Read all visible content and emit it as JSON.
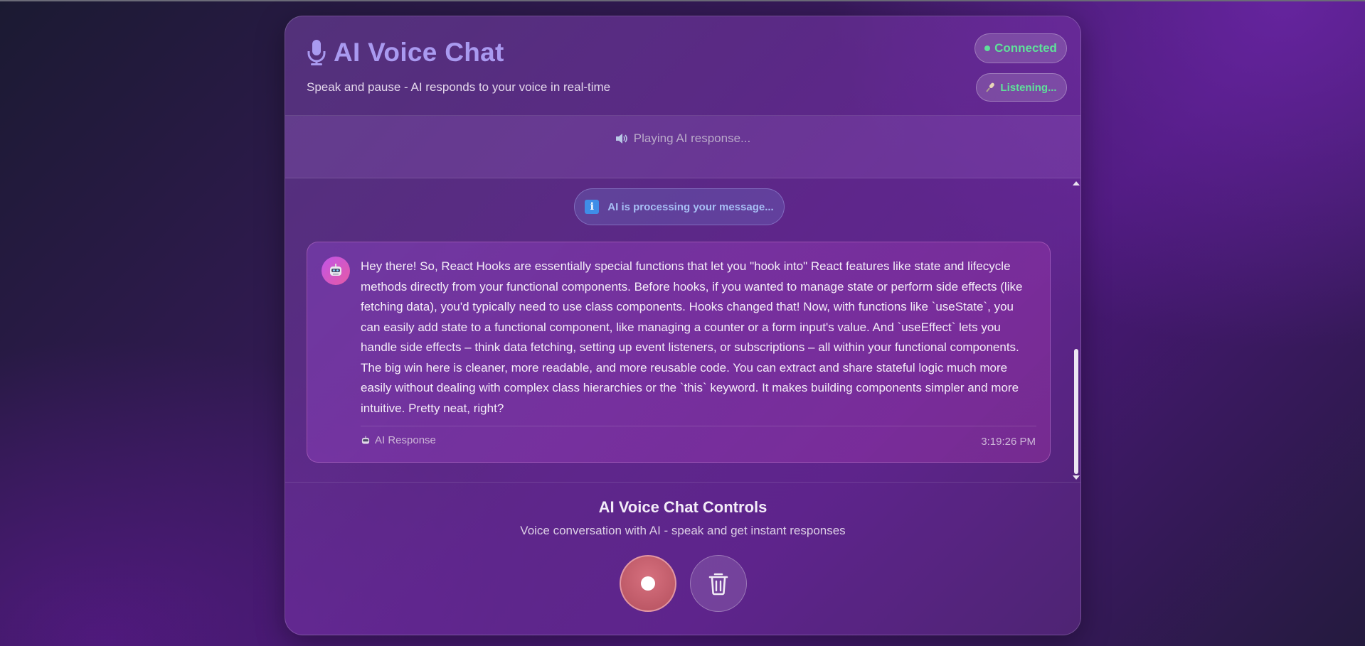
{
  "app": {
    "title": "AI Voice Chat",
    "subtitle": "Speak and pause - AI responds to your voice in real-time"
  },
  "status": {
    "connection": "Connected",
    "listening": "Listening..."
  },
  "playback": {
    "text": "Playing AI response..."
  },
  "processing": {
    "text": "AI is processing your message..."
  },
  "message": {
    "text": "Hey there! So, React Hooks are essentially special functions that let you \"hook into\" React features like state and lifecycle methods directly from your functional components. Before hooks, if you wanted to manage state or perform side effects (like fetching data), you'd typically need to use class components. Hooks changed that! Now, with functions like `useState`, you can easily add state to a functional component, like managing a counter or a form input's value. And `useEffect` lets you handle side effects – think data fetching, setting up event listeners, or subscriptions – all within your functional components. The big win here is cleaner, more readable, and more reusable code. You can extract and share stateful logic much more easily without dealing with complex class hierarchies or the `this` keyword. It makes building components simpler and more intuitive. Pretty neat, right?",
    "label": "AI Response",
    "time": "3:19:26 PM"
  },
  "controls": {
    "title": "AI Voice Chat Controls",
    "subtitle": "Voice conversation with AI - speak and get instant responses"
  },
  "icons": {
    "title": "microphone-icon",
    "listening": "microphone-icon",
    "playback": "speaker-icon",
    "processing": "info-icon",
    "avatar": "robot-icon",
    "record": "record-icon",
    "delete": "trash-icon"
  },
  "colors": {
    "accent": "#a99af0",
    "status_green": "#5fe09a",
    "record": "#c4606e",
    "info": "#3f8de8"
  }
}
